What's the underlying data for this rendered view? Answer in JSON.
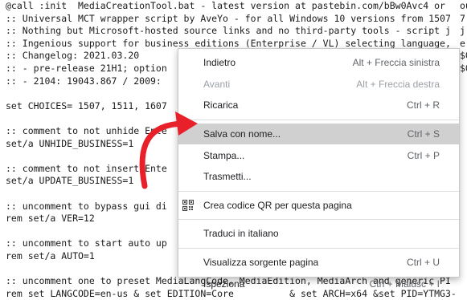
{
  "code_lines": [
    "@call :init  MediaCreationTool.bat - latest version at pastebin.com/bBw0Avc4 or",
    ":: Universal MCT wrapper script by AveYo - for all Windows 10 versions from 1507",
    ":: Nothing but Microsoft-hosted source links and no third-party tools - script j",
    ":: Ingenious support for business editions (Enterprise / VL) selecting language,",
    ":: Changelog: 2021.03.20",
    ":: - pre-release 21H1; option",
    ":: - 2104: 19043.867 / 2009: ",
    "",
    "set CHOICES= 1507, 1511, 1607",
    "",
    ":: comment to not unhide Ente",
    "set/a UNHIDE_BUSINESS=1",
    "",
    ":: comment to not insert Ente",
    "set/a UPDATE_BUSINESS=1",
    "",
    ":: uncomment to bypass gui di",
    "rem set/a VER=12",
    "",
    ":: uncomment to start auto up",
    "rem set/a AUTO=1",
    "",
    ":: uncomment one to preset MediaLangCode, MediaEdition, MediaArch and generic PI",
    "rem set LANGCODE=en-us & set EDITION=Core          & set ARCH=x64 &set PID=YTMG3-"
  ],
  "right_edge_fragments": [
    "ou",
    "7",
    "j",
    "e,",
    "$0",
    "$0",
    "",
    "",
    "",
    "",
    "",
    "",
    "",
    "",
    "",
    "",
    "",
    "",
    "",
    "",
    "",
    "",
    "",
    ""
  ],
  "context_menu": {
    "items": [
      {
        "label": "Indietro",
        "shortcut": "Alt + Freccia sinistra",
        "disabled": false
      },
      {
        "label": "Avanti",
        "shortcut": "Alt + Freccia destra",
        "disabled": true
      },
      {
        "label": "Ricarica",
        "shortcut": "Ctrl + R",
        "disabled": false
      },
      {
        "label": "Salva con nome...",
        "shortcut": "Ctrl + S",
        "disabled": false,
        "highlighted": true
      },
      {
        "label": "Stampa...",
        "shortcut": "Ctrl + P",
        "disabled": false
      },
      {
        "label": "Trasmetti...",
        "shortcut": "",
        "disabled": false
      },
      {
        "label": "Crea codice QR per questa pagina",
        "shortcut": "",
        "icon": "qr-code-icon"
      },
      {
        "label": "Traduci in italiano",
        "shortcut": ""
      },
      {
        "label": "Visualizza sorgente pagina",
        "shortcut": "Ctrl + U"
      },
      {
        "label": "Ispeziona",
        "shortcut": "Ctrl + Maiusc + I"
      }
    ]
  },
  "colors": {
    "arrow": "#e8202a",
    "highlight": "#d0d0d0"
  }
}
